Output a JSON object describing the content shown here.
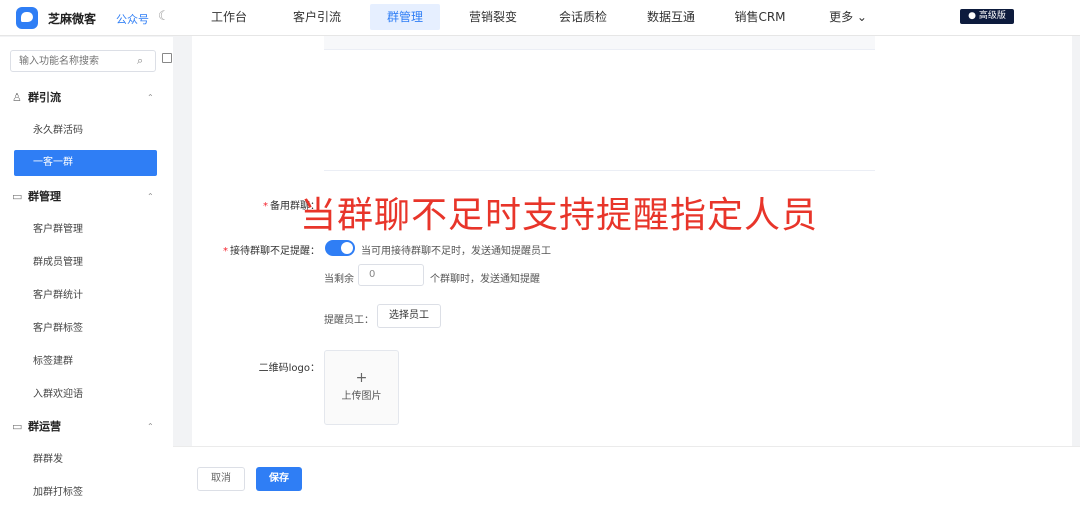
{
  "app": {
    "brand": "芝麻微客",
    "channel": "公众号",
    "edition_badge": "高级版",
    "icons": [
      "logo-icon",
      "moon-icon",
      "chevron-down-icon",
      "search-icon",
      "layout-icon",
      "user-group-icon",
      "chat-icon"
    ]
  },
  "nav": {
    "items": [
      "工作台",
      "客户引流",
      "群管理",
      "营销裂变",
      "会话质检",
      "数据互通",
      "销售CRM",
      "更多 ⌄"
    ],
    "active_index": 2
  },
  "sidebar": {
    "search_placeholder": "输入功能名称搜索",
    "groups": [
      {
        "title": "群引流",
        "items": [
          "永久群活码",
          "一客一群"
        ]
      },
      {
        "title": "群管理",
        "items": [
          "客户群管理",
          "群成员管理",
          "客户群统计",
          "客户群标签",
          "标签建群",
          "入群欢迎语"
        ]
      },
      {
        "title": "群运营",
        "items": [
          "群群发",
          "加群打标签"
        ]
      }
    ],
    "active_item": "一客一群"
  },
  "form": {
    "backup_group_label": "备用群聊：",
    "notify_label": "接待群聊不足提醒：",
    "notify_hint": "当可用接待群聊不足时，发送通知提醒员工",
    "remaining_prefix": "当剩余",
    "remaining_value": "0",
    "remaining_suffix": "个群聊时，发送通知提醒",
    "remind_staff_label": "提醒员工：",
    "select_staff_button": "选择员工",
    "qr_logo_label": "二维码logo：",
    "upload_plus": "+",
    "upload_text": "上传图片"
  },
  "overlay_caption": "当群聊不足时支持提醒指定人员",
  "footer": {
    "cancel": "取消",
    "save": "保存"
  },
  "colors": {
    "primary": "#2f7ef5",
    "overlay_red": "#e8352a",
    "badge_bg": "#0d1b3d"
  }
}
